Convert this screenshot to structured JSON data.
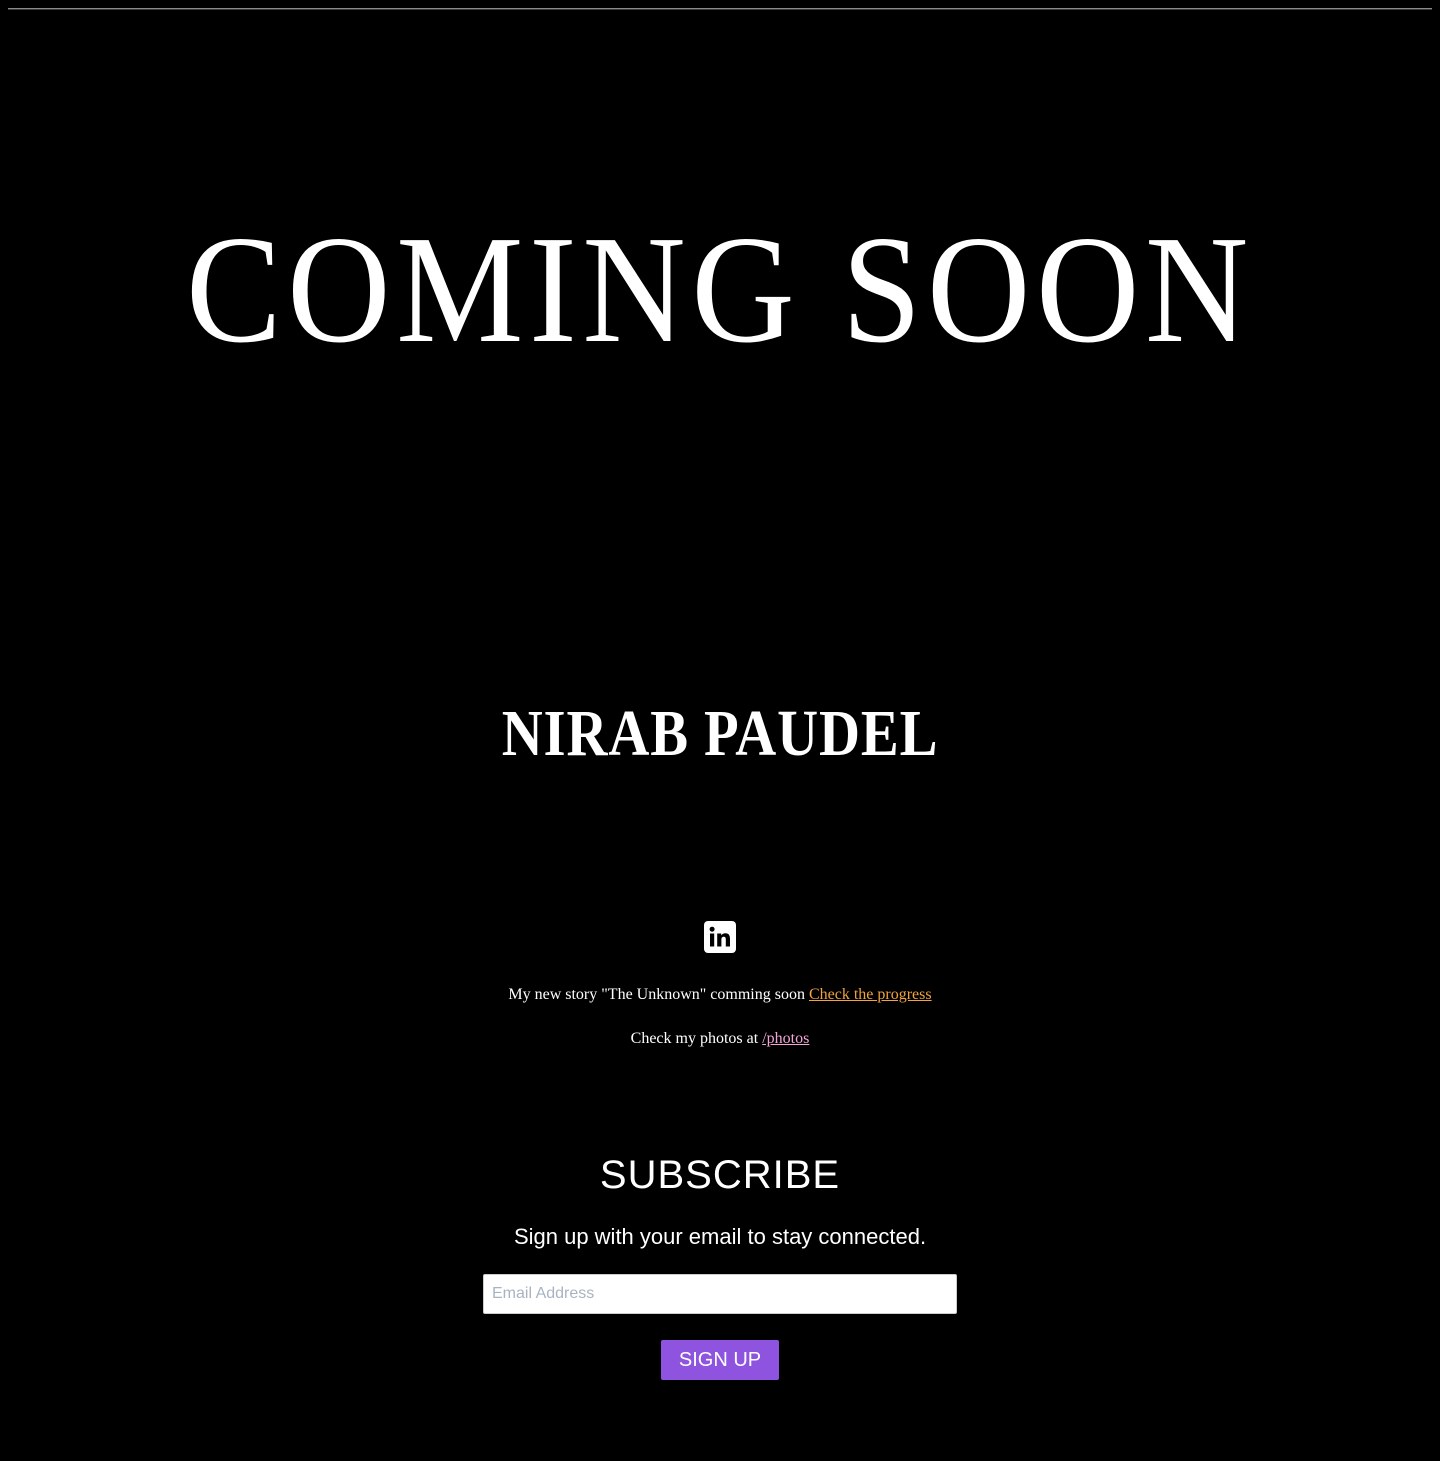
{
  "hero": {
    "title": "COMING SOON"
  },
  "author": {
    "name": "NIRAB PAUDEL"
  },
  "social": {
    "icon": "linkedin-icon"
  },
  "story": {
    "text": "My new story \"The Unknown\" comming soon ",
    "link_label": "Check the progress"
  },
  "photos": {
    "text": "Check my photos at ",
    "link_label": "/photos"
  },
  "subscribe": {
    "heading": "SUBSCRIBE",
    "subtitle": "Sign up with your email to stay connected.",
    "email_placeholder": "Email Address",
    "button_label": "SIGN UP"
  },
  "colors": {
    "background": "#000000",
    "text": "#ffffff",
    "progress_link": "#f0a33e",
    "photos_link": "#f4a6d7",
    "button": "#8e54e0"
  }
}
